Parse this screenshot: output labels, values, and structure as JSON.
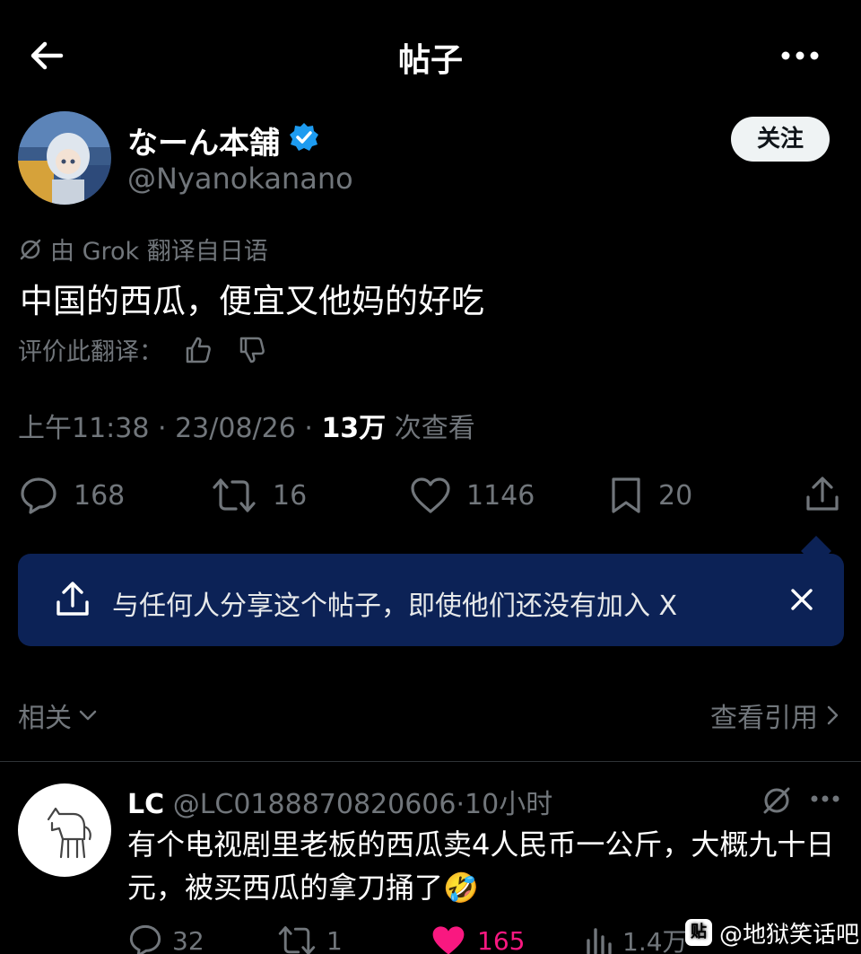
{
  "header": {
    "title": "帖子"
  },
  "author": {
    "display_name": "なーん本舗",
    "handle": "@Nyanokanano",
    "follow_label": "关注"
  },
  "translation": {
    "source_note": "由 Grok 翻译自日语",
    "post_text": "中国的西瓜，便宜又他妈的好吃",
    "rate_label": "评价此翻译："
  },
  "meta": {
    "time": "上午11:38",
    "sep1": " · ",
    "date": "23/08/26",
    "sep2": " · ",
    "views": "13万",
    "views_suffix": " 次查看"
  },
  "actions": {
    "replies": "168",
    "reposts": "16",
    "likes": "1146",
    "bookmarks": "20"
  },
  "share_banner": {
    "text": "与任何人分享这个帖子，即使他们还没有加入 X"
  },
  "related": {
    "label": "相关",
    "view_quotes": "查看引用"
  },
  "reply": {
    "name": "LC",
    "handle": "@LC0188870820606",
    "sep": "·",
    "time": "10小时",
    "text": "有个电视剧里老板的西瓜卖4人民币一公斤，大概九十日元，被买西瓜的拿刀捅了🤣",
    "replies": "32",
    "reposts": "1",
    "likes": "165",
    "views": "1.4万"
  },
  "watermark": {
    "logo": "贴",
    "text": "@地狱笑话吧"
  },
  "colors": {
    "background": "#000000",
    "banner": "#0c2256",
    "verified": "#1d9bf0",
    "muted": "#71767b",
    "like_pink": "#f91880"
  }
}
